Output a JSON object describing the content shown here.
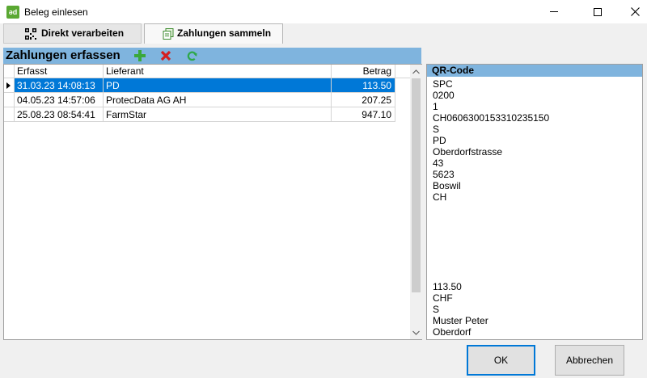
{
  "window": {
    "title": "Beleg einlesen",
    "icon_text": "ǝd"
  },
  "tabs": [
    {
      "label": "Direkt verarbeiten",
      "icon": "qr-code-icon",
      "active": false
    },
    {
      "label": "Zahlungen sammeln",
      "icon": "documents-icon",
      "active": true
    }
  ],
  "section": {
    "title": "Zahlungen erfassen",
    "tools": [
      "add-icon",
      "delete-icon",
      "refresh-icon"
    ]
  },
  "grid": {
    "columns": [
      "Erfasst",
      "Lieferant",
      "Betrag"
    ],
    "rows": [
      {
        "erfasst": "31.03.23 14:08:13",
        "lieferant": "PD",
        "betrag": "113.50",
        "selected": true
      },
      {
        "erfasst": "04.05.23 14:57:06",
        "lieferant": "ProtecData AG AH",
        "betrag": "207.25",
        "selected": false
      },
      {
        "erfasst": "25.08.23 08:54:41",
        "lieferant": "FarmStar",
        "betrag": "947.10",
        "selected": false
      }
    ]
  },
  "qr": {
    "header": "QR-Code",
    "lines_top": [
      "SPC",
      "0200",
      "1",
      "CH0606300153310235150",
      "S",
      "PD",
      "Oberdorfstrasse",
      "43",
      "5623",
      "Boswil",
      "CH"
    ],
    "lines_bottom": [
      "113.50",
      "CHF",
      "S",
      "Muster Peter",
      "Oberdorf"
    ]
  },
  "buttons": {
    "ok": "OK",
    "cancel": "Abbrechen"
  },
  "colors": {
    "accent": "#0078d7",
    "section_header": "#7fb4de"
  }
}
